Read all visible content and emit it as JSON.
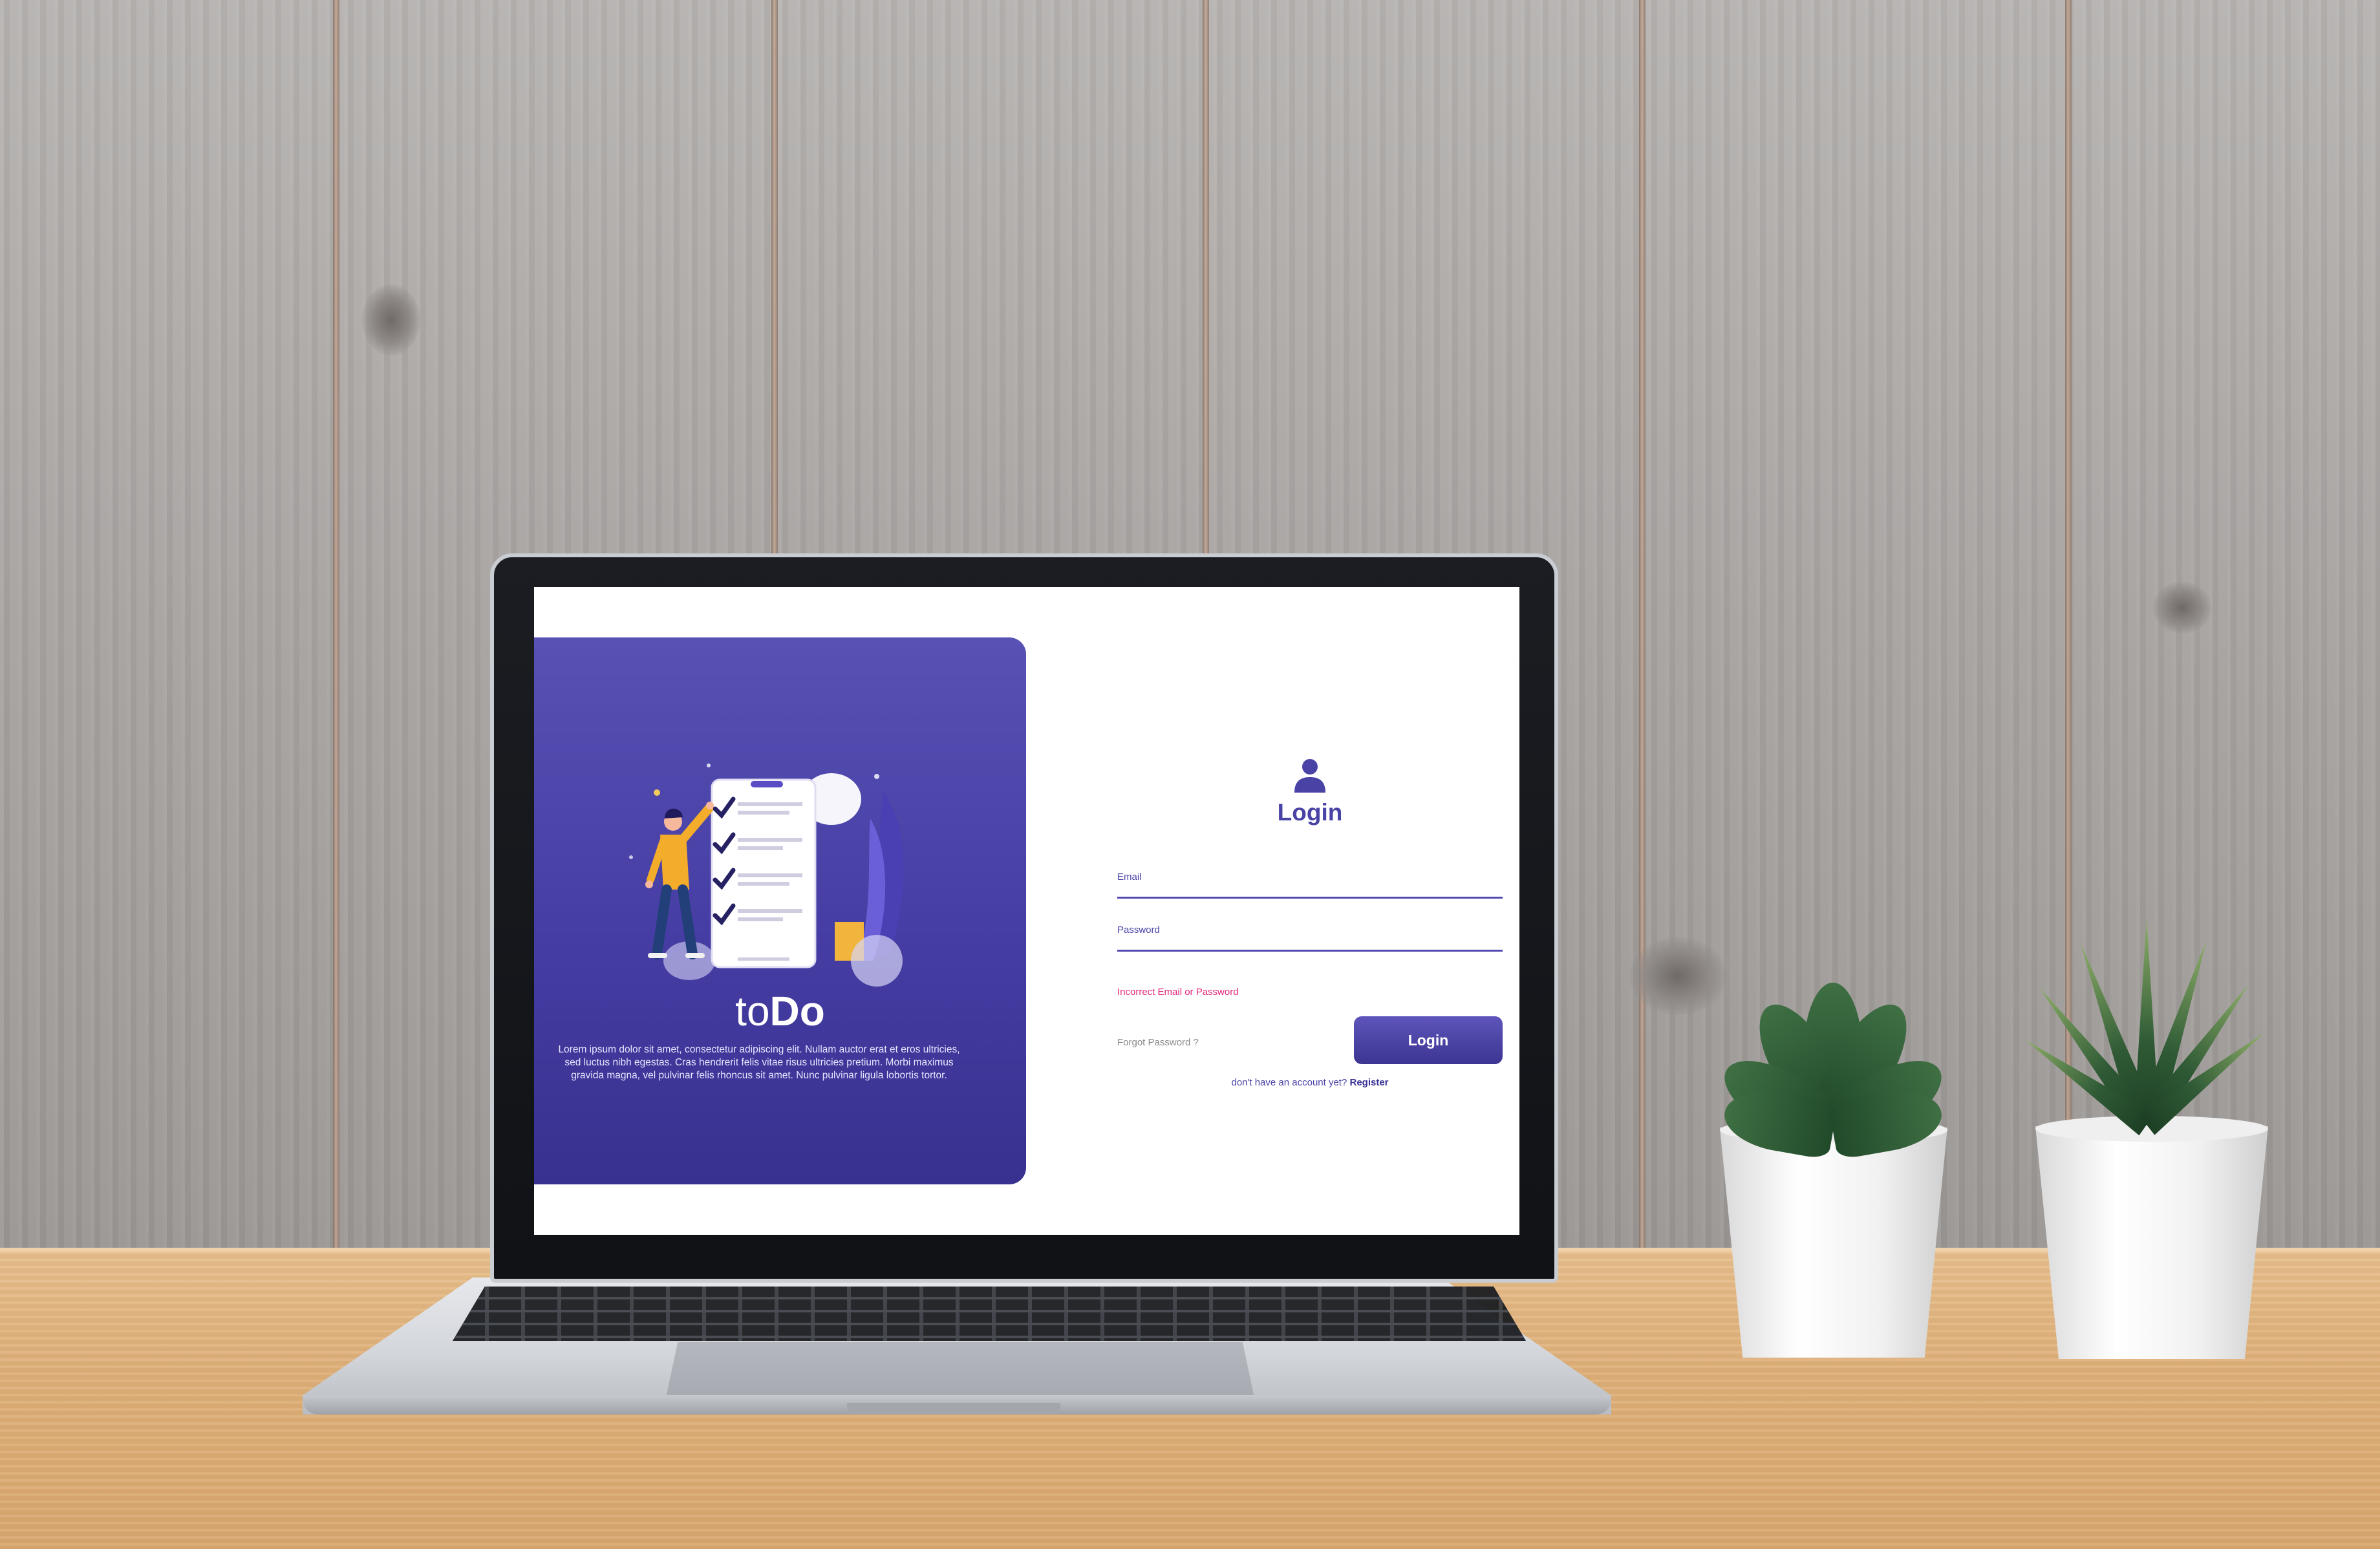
{
  "brand": {
    "name_light": "to",
    "name_bold": "Do",
    "description": "Lorem ipsum dolor sit amet, consectetur adipiscing elit. Nullam auctor erat et eros ultricies, sed luctus nibh egestas. Cras hendrerit felis vitae risus ultricies pretium. Morbi maximus gravida magna, vel pulvinar felis rhoncus sit amet. Nunc pulvinar ligula lobortis tortor."
  },
  "login": {
    "icon": "user-icon",
    "title": "Login",
    "email_label": "Email",
    "email_value": "",
    "password_label": "Password",
    "password_value": "",
    "error": "Incorrect Email or Password",
    "forgot": "Forgot Password ?",
    "button": "Login",
    "register_prompt": "don't have an account yet?",
    "register_link": "Register"
  },
  "colors": {
    "primary": "#4a43a6",
    "panel_gradient_top": "#5852b4",
    "panel_gradient_bottom": "#38318f",
    "error": "#e2247a"
  }
}
